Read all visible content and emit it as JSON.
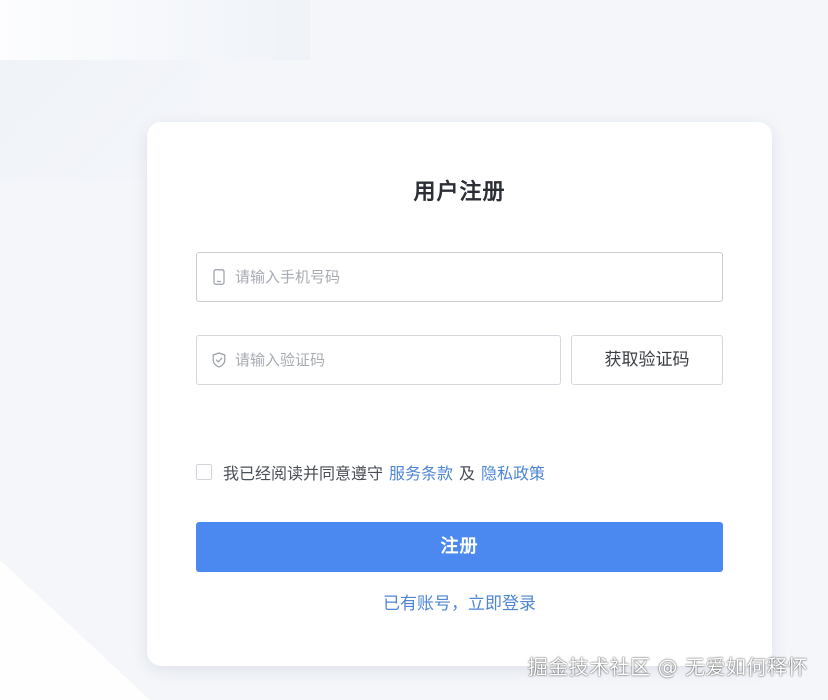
{
  "colors": {
    "primary": "#4b89f0",
    "link": "#4e86d6",
    "background": "#f4f6fa",
    "card": "#ffffff"
  },
  "form": {
    "title": "用户注册",
    "phone": {
      "placeholder": "请输入手机号码",
      "value": "",
      "icon": "mobile-phone-icon"
    },
    "code": {
      "placeholder": "请输入验证码",
      "value": "",
      "icon": "shield-check-icon"
    },
    "get_code_label": "获取验证码",
    "agreement": {
      "checked": false,
      "prefix": "我已经阅读并同意遵守",
      "terms_label": "服务条款",
      "connector": "及",
      "privacy_label": "隐私政策"
    },
    "submit_label": "注册",
    "login_link_label": "已有账号，立即登录"
  },
  "watermark": "掘金技术社区 @ 无爱如何释怀"
}
